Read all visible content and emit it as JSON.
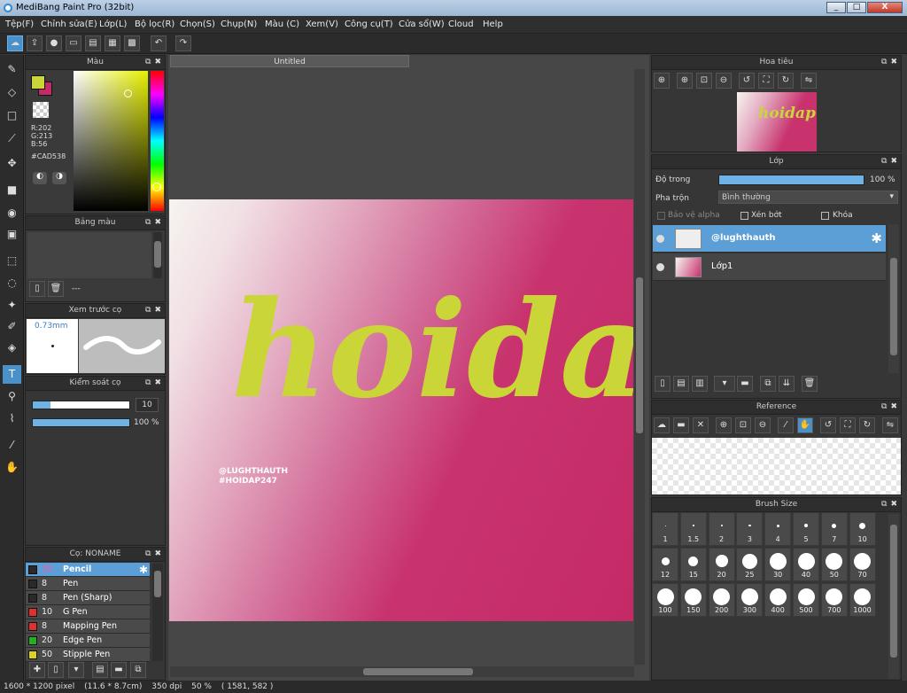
{
  "window": {
    "title": "MediBang Paint Pro (32bit)",
    "minimize": "_",
    "maximize": "□",
    "close": "X"
  },
  "menu": [
    "Tệp(F)",
    "Chỉnh sửa(E)",
    "Lớp(L)",
    "Bộ lọc(R)",
    "Chọn(S)",
    "Chụp(N)",
    "Màu (C)",
    "Xem(V)",
    "Công cụ(T)",
    "Cửa sổ(W)",
    "Cloud",
    "Help"
  ],
  "color_panel": {
    "title": "Màu",
    "r": "R:202",
    "g": "G:213",
    "b": "B:56",
    "hex": "#CAD538",
    "fg_color": "#CAD538",
    "bg_color": "#C42A66"
  },
  "palette_panel": {
    "title": "Bảng màu",
    "label": "---"
  },
  "brush_preview": {
    "title": "Xem trước cọ",
    "size": "0.73mm"
  },
  "brush_control": {
    "title": "Kiểm soát cọ",
    "size_value": "10",
    "opacity_value": "100 %",
    "size_fraction": 0.18,
    "opacity_fraction": 1.0
  },
  "brush_list": {
    "title": "Cọ: NONAME",
    "items": [
      {
        "size": "20",
        "name": "Pencil",
        "color": "#2a2a2a",
        "selected": true
      },
      {
        "size": "8",
        "name": "Pen",
        "color": "#2a2a2a"
      },
      {
        "size": "8",
        "name": "Pen (Sharp)",
        "color": "#2a2a2a"
      },
      {
        "size": "10",
        "name": "G Pen",
        "color": "#e03030"
      },
      {
        "size": "8",
        "name": "Mapping Pen",
        "color": "#e03030"
      },
      {
        "size": "20",
        "name": "Edge Pen",
        "color": "#20b020"
      },
      {
        "size": "50",
        "name": "Stipple Pen",
        "color": "#e0d020"
      }
    ]
  },
  "canvas": {
    "tab": "Untitled",
    "art_title": "hoidap",
    "handle_line1": "@LUGHTHAUTH",
    "handle_line2": "#HOIDAP247"
  },
  "navigator": {
    "title": "Hoa tiêu",
    "thumb_text": "hoidap"
  },
  "layer_panel": {
    "title": "Lớp",
    "opacity_label": "Độ trong",
    "opacity_value": "100 %",
    "opacity_fraction": 1.0,
    "blend_label": "Pha trộn",
    "blend_value": "Bình thường",
    "protect_alpha": "Bảo vệ alpha",
    "clipping": "Xén bớt",
    "lock": "Khóa",
    "layers": [
      {
        "name": "@lughthauth",
        "selected": true
      },
      {
        "name": "Lớp1",
        "selected": false
      }
    ]
  },
  "reference": {
    "title": "Reference"
  },
  "brush_size": {
    "title": "Brush Size",
    "sizes": [
      "1",
      "1.5",
      "2",
      "3",
      "4",
      "5",
      "7",
      "10",
      "12",
      "15",
      "20",
      "25",
      "30",
      "40",
      "50",
      "70",
      "100",
      "150",
      "200",
      "300",
      "400",
      "500",
      "700",
      "1000"
    ]
  },
  "status": {
    "dims": "1600 * 1200 pixel",
    "cm": "(11.6 * 8.7cm)",
    "dpi": "350 dpi",
    "zoom": "50 %",
    "coords": "( 1581, 582 )"
  }
}
